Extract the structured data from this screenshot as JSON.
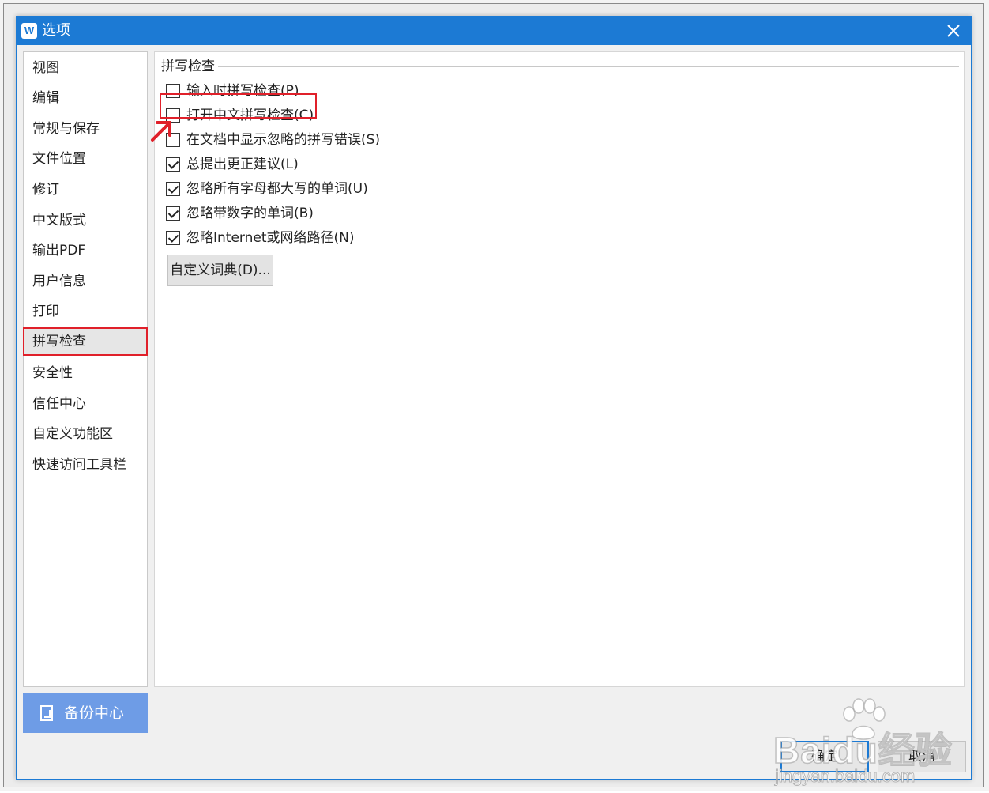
{
  "window": {
    "app_icon_glyph": "W",
    "title": "选项"
  },
  "sidebar": {
    "items": [
      {
        "label": "视图"
      },
      {
        "label": "编辑"
      },
      {
        "label": "常规与保存"
      },
      {
        "label": "文件位置"
      },
      {
        "label": "修订"
      },
      {
        "label": "中文版式"
      },
      {
        "label": "输出PDF"
      },
      {
        "label": "用户信息"
      },
      {
        "label": "打印"
      },
      {
        "label": "拼写检查",
        "selected": true
      },
      {
        "label": "安全性"
      },
      {
        "label": "信任中心"
      },
      {
        "label": "自定义功能区"
      },
      {
        "label": "快速访问工具栏"
      }
    ],
    "backup_label": "备份中心"
  },
  "spellcheck": {
    "group_title": "拼写检查",
    "options": [
      {
        "label": "输入时拼写检查(P)",
        "checked": false
      },
      {
        "label": "打开中文拼写检查(C)",
        "checked": false
      },
      {
        "label": "在文档中显示忽略的拼写错误(S)",
        "checked": false
      },
      {
        "label": "总提出更正建议(L)",
        "checked": true
      },
      {
        "label": "忽略所有字母都大写的单词(U)",
        "checked": true
      },
      {
        "label": "忽略带数字的单词(B)",
        "checked": true
      },
      {
        "label": "忽略Internet或网络路径(N)",
        "checked": true
      }
    ],
    "custom_dict_label": "自定义词典(D)..."
  },
  "footer": {
    "ok_label": "确定",
    "cancel_label": "取消"
  },
  "watermark": {
    "brand": "Baidu经验",
    "url": "jingyan.baidu.com"
  },
  "colors": {
    "accent": "#1c7ad4",
    "highlight": "#e0202a",
    "backup": "#6e9ce6"
  }
}
